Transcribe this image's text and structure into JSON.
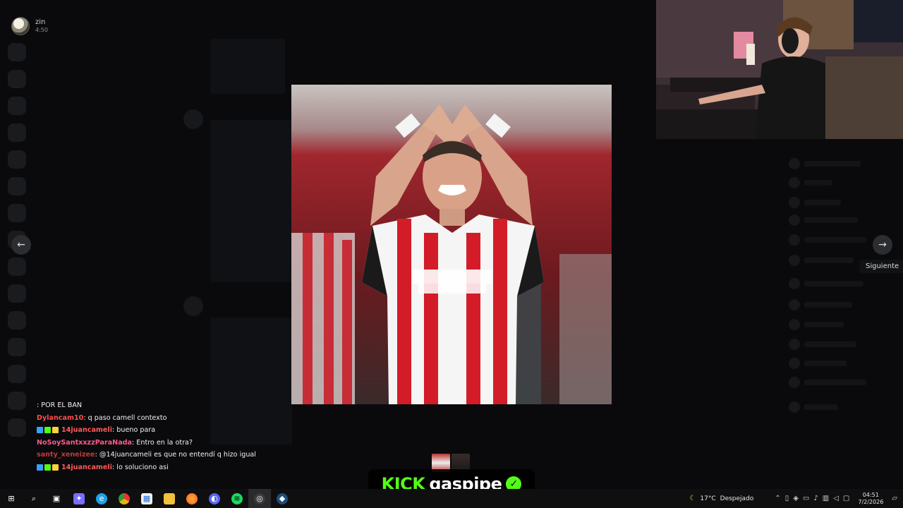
{
  "user": {
    "name": "zin",
    "time": "4:50"
  },
  "viewer": {
    "next_tooltip": "Siguiente",
    "prev_icon": "arrow-left-icon",
    "next_icon": "arrow-right-icon"
  },
  "chat": [
    {
      "user": "",
      "user_color": "#53fc18",
      "badges": [],
      "message": ": POR EL BAN"
    },
    {
      "user": "Dylancam10",
      "user_color": "#ff4d4d",
      "badges": [],
      "message": ": q paso camell contexto"
    },
    {
      "user": "14juancameli",
      "user_color": "#ff5a5a",
      "badges": [
        "#3aa0ff",
        "#53fc18",
        "#ffd23a"
      ],
      "message": ": bueno para"
    },
    {
      "user": "NoSoySantxxzzParaNada",
      "user_color": "#ff5a8a",
      "badges": [],
      "message": ": Entro en la otra?"
    },
    {
      "user": "santy_xeneizee",
      "user_color": "#c23a3a",
      "badges": [],
      "message": ": @14juancameli es que no entendí q hizo igual"
    },
    {
      "user": "14juancameli",
      "user_color": "#ff5a5a",
      "badges": [
        "#3aa0ff",
        "#53fc18",
        "#ffd23a"
      ],
      "message": ": lo soluciono asi"
    }
  ],
  "overlay": {
    "brand": "KICK",
    "channel": "gaspipe",
    "brand_color": "#53fc18"
  },
  "taskbar": {
    "apps": [
      {
        "name": "windows-start-icon",
        "glyph": "⊞",
        "color": "#ffffff"
      },
      {
        "name": "search-icon",
        "glyph": "⌕",
        "color": "#ffffff"
      },
      {
        "name": "task-view-icon",
        "glyph": "▣",
        "color": "#ffffff"
      },
      {
        "name": "copilot-icon",
        "glyph": "✦",
        "color": "#7a6cff"
      },
      {
        "name": "edge-icon",
        "glyph": "e",
        "color": "#1fa0e8"
      },
      {
        "name": "chrome-icon",
        "glyph": "●",
        "color": "#e8b40f"
      },
      {
        "name": "store-icon",
        "glyph": "▦",
        "color": "#f2f2f2"
      },
      {
        "name": "file-explorer-icon",
        "glyph": "▬",
        "color": "#f3c13a"
      },
      {
        "name": "firefox-icon",
        "glyph": "◉",
        "color": "#ff7a1f"
      },
      {
        "name": "discord-icon",
        "glyph": "◐",
        "color": "#5865f2"
      },
      {
        "name": "spotify-icon",
        "glyph": "≋",
        "color": "#1ed760"
      },
      {
        "name": "obs-icon",
        "glyph": "◎",
        "color": "#d0d0d0"
      },
      {
        "name": "steam-icon",
        "glyph": "◆",
        "color": "#1b7dbf"
      }
    ],
    "weather": {
      "temp": "17°C",
      "condition": "Despejado"
    },
    "time": "04:51",
    "date": "7/2/2026"
  }
}
